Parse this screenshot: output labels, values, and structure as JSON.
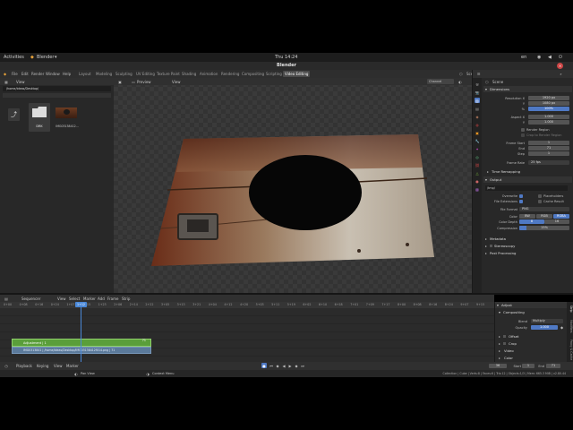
{
  "system": {
    "activities": "Activities",
    "app_name": "Blender",
    "clock": "Thu 14:24",
    "locale": "en",
    "power": "⏻"
  },
  "window_title": "Blender",
  "menu": [
    "File",
    "Edit",
    "Render",
    "Window",
    "Help"
  ],
  "workspaces": [
    "Layout",
    "Modeling",
    "Sculpting",
    "UV Editing",
    "Texture Paint",
    "Shading",
    "Animation",
    "Rendering",
    "Compositing",
    "Scripting",
    "Video Editing"
  ],
  "active_workspace": "Video Editing",
  "scene": {
    "label": "Scene",
    "view_layer": "View Layer"
  },
  "file_browser": {
    "view_label": "View",
    "path": "/home/ideas/Desktop/",
    "items": [
      {
        "name": ""
      },
      {
        "name": "DRK"
      },
      {
        "name": "IMG03138412..."
      }
    ]
  },
  "preview": {
    "mode": "Preview",
    "view": "View",
    "channel": "Channel"
  },
  "properties": {
    "scene_label": "Scene",
    "dimensions": "Dimensions",
    "resolution_x_label": "Resolution X",
    "resolution_x": "1920 px",
    "y_label": "Y",
    "resolution_y": "1080 px",
    "percent": "100%",
    "aspect_x_label": "Aspect X",
    "aspect_x": "1.000",
    "aspect_y": "1.000",
    "render_region": "Render Region",
    "crop_label": "Crop to Render Region",
    "frame_start_label": "Frame Start",
    "frame_start": "1",
    "end_label": "End",
    "frame_end": "71",
    "step_label": "Step",
    "frame_step": "1",
    "frame_rate_label": "Frame Rate",
    "frame_rate": "25 fps",
    "time_remapping": "Time Remapping",
    "output": "Output",
    "output_path": "/tmp/",
    "overwrite": "Overwrite",
    "placeholders": "Placeholders",
    "file_extensions": "File Extensions",
    "cache_result": "Cache Result",
    "file_format_label": "File Format",
    "file_format": "PNG",
    "color_label": "Color",
    "color_modes": [
      "BW",
      "RGB",
      "RGBA"
    ],
    "color_depth_label": "Color Depth",
    "color_depths": [
      "8",
      "16"
    ],
    "compression_label": "Compression",
    "compression": "15%",
    "metadata": "Metadata",
    "stereoscopy": "Stereoscopy",
    "post_processing": "Post Processing"
  },
  "sequencer": {
    "mode": "Sequencer",
    "menus": [
      "View",
      "Select",
      "Marker",
      "Add",
      "Frame",
      "Strip"
    ],
    "ticks": [
      "0+00",
      "0+08",
      "0+16",
      "0+24",
      "1+07",
      "1+15",
      "1+23",
      "2+06",
      "2+14",
      "2+22",
      "3+05",
      "3+13",
      "3+21",
      "4+04",
      "4+12",
      "4+20",
      "5+03",
      "5+11",
      "5+19",
      "6+02",
      "6+10",
      "6+18",
      "7+01",
      "7+09",
      "7+17",
      "8+00",
      "8+08",
      "8+16",
      "8+24",
      "9+07",
      "9+15"
    ],
    "current": "1+12",
    "strip_adjust": "Adjustment | 1",
    "strip_adjust_end": "71",
    "strip_image": "IMG0313841 | /home/ideas/Desktop/IMG03138412f014.png | 71"
  },
  "strip_panel": {
    "adjust": "Adjust",
    "compositing": "Compositing",
    "blend_label": "Blend",
    "blend": "Multiply",
    "opacity_label": "Opacity",
    "opacity": "1.000",
    "offset": "Offset",
    "crop": "Crop",
    "video": "Video",
    "color": "Color",
    "tabs": [
      "Strip",
      "Modifiers",
      "Proxy & Cache"
    ]
  },
  "playback_bar": {
    "playback": "Playback",
    "keying": "Keying",
    "view": "View",
    "marker": "Marker",
    "current_frame": "36",
    "start_label": "Start",
    "start": "1",
    "end_label": "End",
    "end": "71"
  },
  "status_bar": {
    "pan_view": "Pan View",
    "context_menu": "Context Menu",
    "info": "Collection | Cube | Verts:8 | Faces:6 | Tris:12 | Objects:1/3 | Mem: 665.3 MiB | v2.80.44"
  },
  "colors": {
    "accent_blue": "#4f79c4",
    "strip_green": "#5a9e3a",
    "strip_image": "#5b7a9b",
    "playhead": "#4a88d8"
  }
}
